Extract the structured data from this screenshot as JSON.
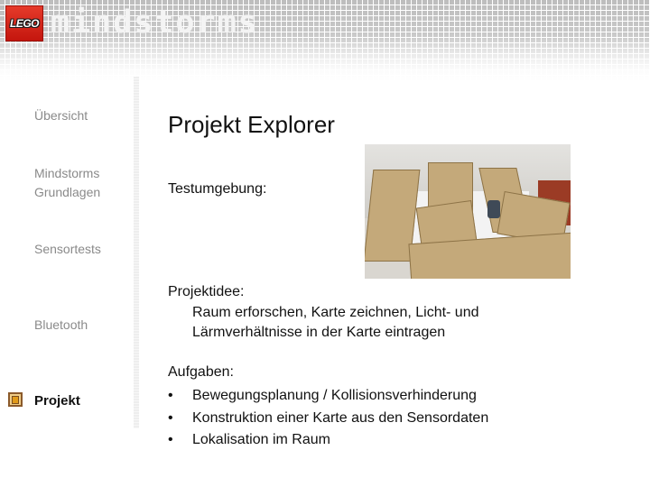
{
  "header": {
    "logo_text": "LEGO",
    "brand_text": "mindstorms"
  },
  "sidebar": {
    "items": [
      {
        "label": "Übersicht",
        "active": false
      },
      {
        "label": "Mindstorms Grundlagen",
        "line1": "Mindstorms",
        "line2": "Grundlagen",
        "active": false
      },
      {
        "label": "Sensortests",
        "active": false
      },
      {
        "label": "Bluetooth",
        "active": false
      },
      {
        "label": "Projekt",
        "active": true,
        "icon": "project-icon"
      }
    ]
  },
  "main": {
    "title": "Projekt Explorer",
    "test_env_label": "Testumgebung:",
    "photo_description": "Cardboard maze with Mindstorms robot",
    "idea_label": "Projektidee:",
    "idea_text_line1": "Raum erforschen, Karte zeichnen, Licht- und",
    "idea_text_line2": "Lärmverhältnisse in der Karte eintragen",
    "tasks_label": "Aufgaben:",
    "bullet_glyph": "•",
    "tasks": [
      "Bewegungsplanung / Kollisionsverhinderung",
      "Konstruktion einer Karte aus den Sensordaten",
      "Lokalisation im Raum"
    ]
  }
}
